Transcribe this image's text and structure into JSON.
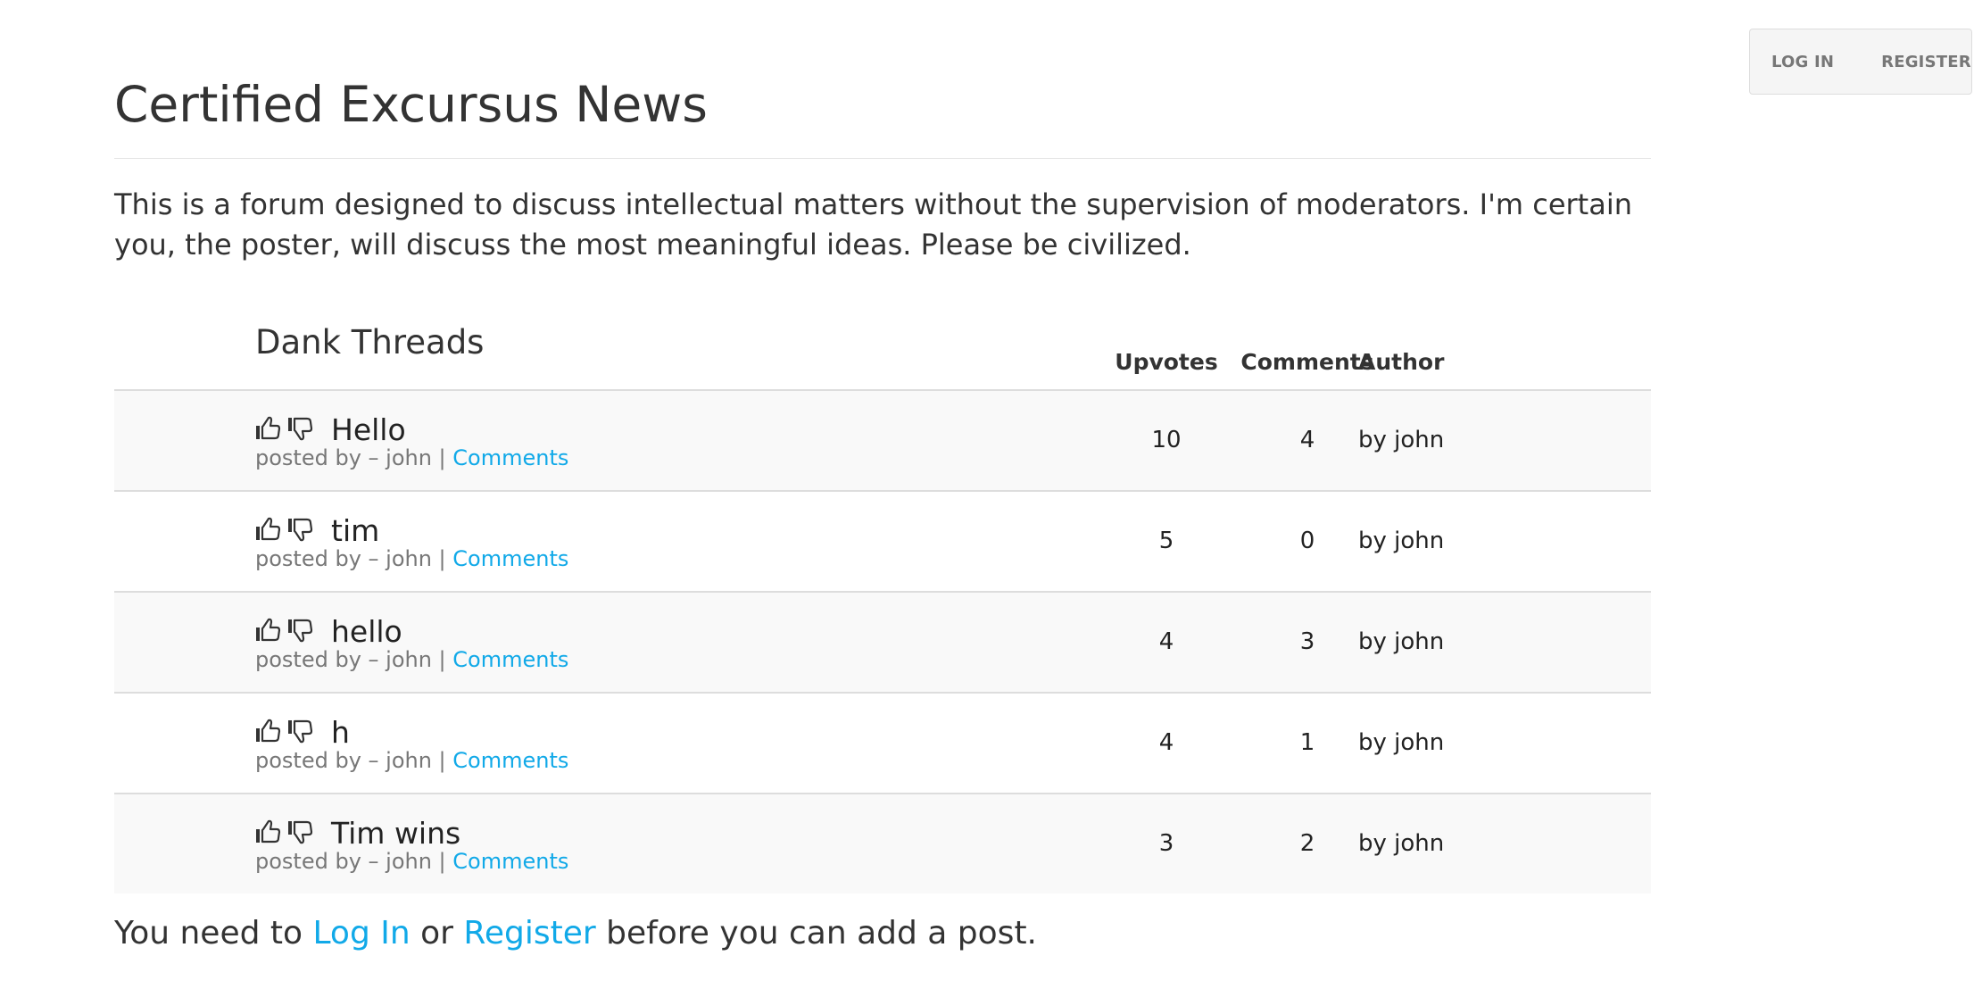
{
  "auth": {
    "login_label": "LOG IN",
    "register_label": "REGISTER"
  },
  "site": {
    "title": "Certified Excursus News",
    "intro": "This is a forum designed to discuss intellectual matters without the supervision of moderators. I'm certain you, the poster, will discuss the most meaningful ideas. Please be civilized."
  },
  "threads": {
    "heading": "Dank Threads",
    "columns": {
      "upvotes": "Upvotes",
      "comments": "Comments",
      "author": "Author"
    },
    "meta_prefix": "posted by – john |",
    "meta_link": "Comments",
    "rows": [
      {
        "title": "Hello",
        "upvotes": "10",
        "comments": "4",
        "author": "by john"
      },
      {
        "title": "tim",
        "upvotes": "5",
        "comments": "0",
        "author": "by john"
      },
      {
        "title": "hello",
        "upvotes": "4",
        "comments": "3",
        "author": "by john"
      },
      {
        "title": "h",
        "upvotes": "4",
        "comments": "1",
        "author": "by john"
      },
      {
        "title": "Tim wins",
        "upvotes": "3",
        "comments": "2",
        "author": "by john"
      }
    ]
  },
  "footer": {
    "prefix": "You need to",
    "login_link": "Log In",
    "middle": "or",
    "register_link": "Register",
    "suffix": "before you can add a post."
  },
  "colors": {
    "link": "#11a9e8",
    "row_alt": "#f9f9f9",
    "divider": "#dddddd"
  },
  "icons": {
    "upvote": "thumb-up-icon",
    "downvote": "thumb-down-icon"
  }
}
